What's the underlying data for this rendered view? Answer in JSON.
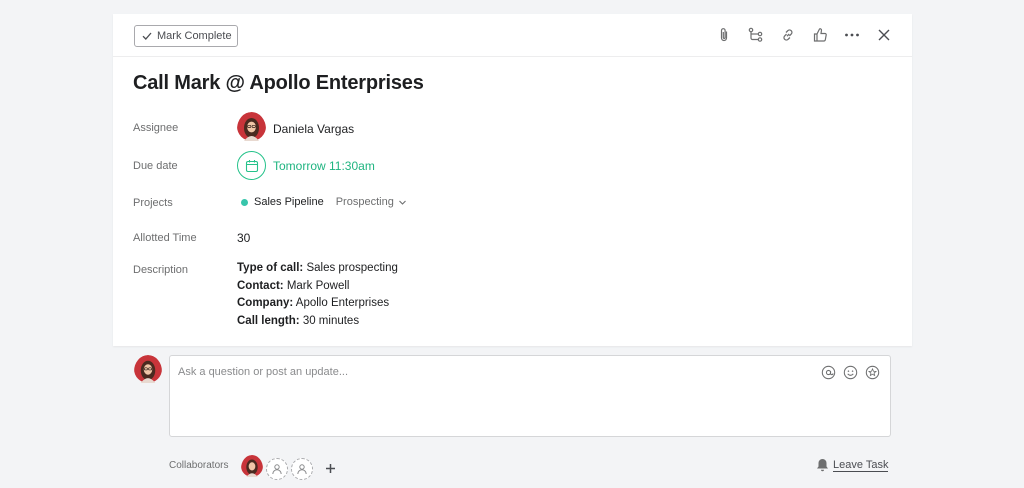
{
  "toolbar": {
    "mark_complete_label": "Mark Complete",
    "icons": [
      "paperclip-icon",
      "subtask-icon",
      "link-icon",
      "like-icon",
      "more-icon",
      "close-icon"
    ]
  },
  "task": {
    "title": "Call Mark @ Apollo Enterprises",
    "fields": {
      "assignee_label": "Assignee",
      "assignee_name": "Daniela Vargas",
      "due_label": "Due date",
      "due_value": "Tomorrow 11:30am",
      "projects_label": "Projects",
      "project_name": "Sales Pipeline",
      "project_section": "Prospecting",
      "allotted_label": "Allotted Time",
      "allotted_value": "30",
      "description_label": "Description"
    },
    "description": [
      {
        "key": "Type of call:",
        "value": " Sales prospecting"
      },
      {
        "key": "Contact:",
        "value": " Mark Powell"
      },
      {
        "key": "Company:",
        "value": " Apollo Enterprises"
      },
      {
        "key": "Call length:",
        "value": " 30 minutes"
      }
    ]
  },
  "comment": {
    "placeholder": "Ask a question or post an update...",
    "tools": [
      "at-mention-icon",
      "emoji-icon",
      "star-icon"
    ]
  },
  "collaborators": {
    "label": "Collaborators",
    "leave_label": "Leave Task"
  },
  "colors": {
    "accent_green": "#1fb480",
    "project_dot": "#37c5ab",
    "avatar_red": "#c8343a"
  }
}
